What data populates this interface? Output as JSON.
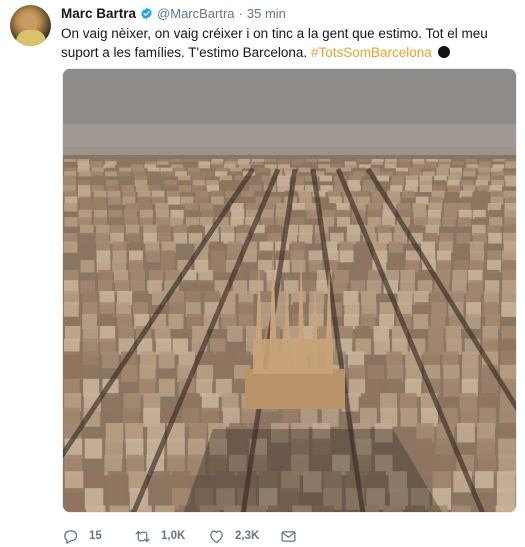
{
  "user": {
    "name": "Marc Bartra",
    "handle": "@MarcBartra",
    "separator": "·",
    "time": "35 min",
    "verified_color": "#1da1f2"
  },
  "tweet": {
    "text": "On vaig nèixer, on vaig créixer i on tinc a la gent que estimo. Tot el meu suport a les famílies. T'estimo Barcelona.",
    "hashtag": "#TotsSomBarcelona",
    "hashtag_color": "#e8a22d",
    "emoji": "black-circle"
  },
  "photo": {
    "icon": "aerial-city-photo"
  },
  "actions": {
    "reply": {
      "icon": "reply-icon",
      "count": "15"
    },
    "retweet": {
      "icon": "retweet-icon",
      "count": "1,0K"
    },
    "like": {
      "icon": "heart-icon",
      "count": "2,3K"
    },
    "dm": {
      "icon": "envelope-icon"
    }
  },
  "colors": {
    "text": "#14171a",
    "muted": "#657786"
  }
}
